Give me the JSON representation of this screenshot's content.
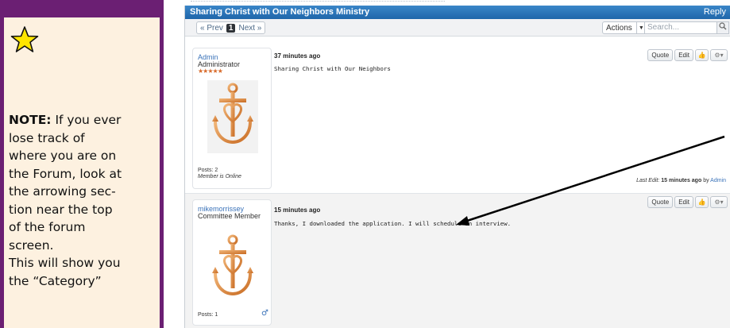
{
  "note": {
    "heading": "NOTE:",
    "lines": [
      " If you ever",
      "lose track  of",
      "where you are on",
      "the Forum, look at",
      "the arrowing sec-",
      "tion near  the top",
      "of the forum",
      "screen.",
      "This will show you",
      "the  “Category”"
    ]
  },
  "forum": {
    "title": "Sharing Christ with Our Neighbors Ministry",
    "reply_label": "Reply",
    "pager": {
      "prev": "« Prev",
      "current": "1",
      "next": "Next »"
    },
    "actions_label": "Actions",
    "search_placeholder": "Search...",
    "posts": [
      {
        "username": "Admin",
        "role": "Administrator",
        "stars": "★★★★★",
        "posts_count": "Posts: 2",
        "status": "Member is Online",
        "time": "37 minutes ago",
        "body": "Sharing Christ with Our Neighbors",
        "quote": "Quote",
        "edit": "Edit",
        "last_edit_label": "Last Edit:",
        "last_edit_time": "15 minutes ago",
        "last_edit_by_word": "by",
        "last_edit_by": "Admin"
      },
      {
        "username": "mikemorrissey",
        "role": "Committee Member",
        "posts_count": "Posts: 1",
        "time": "15 minutes ago",
        "body": "Thanks, I downloaded the application. I will schedule an interview.",
        "quote": "Quote",
        "edit": "Edit"
      }
    ]
  },
  "colors": {
    "panel_border": "#6b1f73",
    "panel_bg": "#fdf1e0",
    "titlebar": "#2a75ba",
    "avatar_copper": "#d98a46"
  }
}
